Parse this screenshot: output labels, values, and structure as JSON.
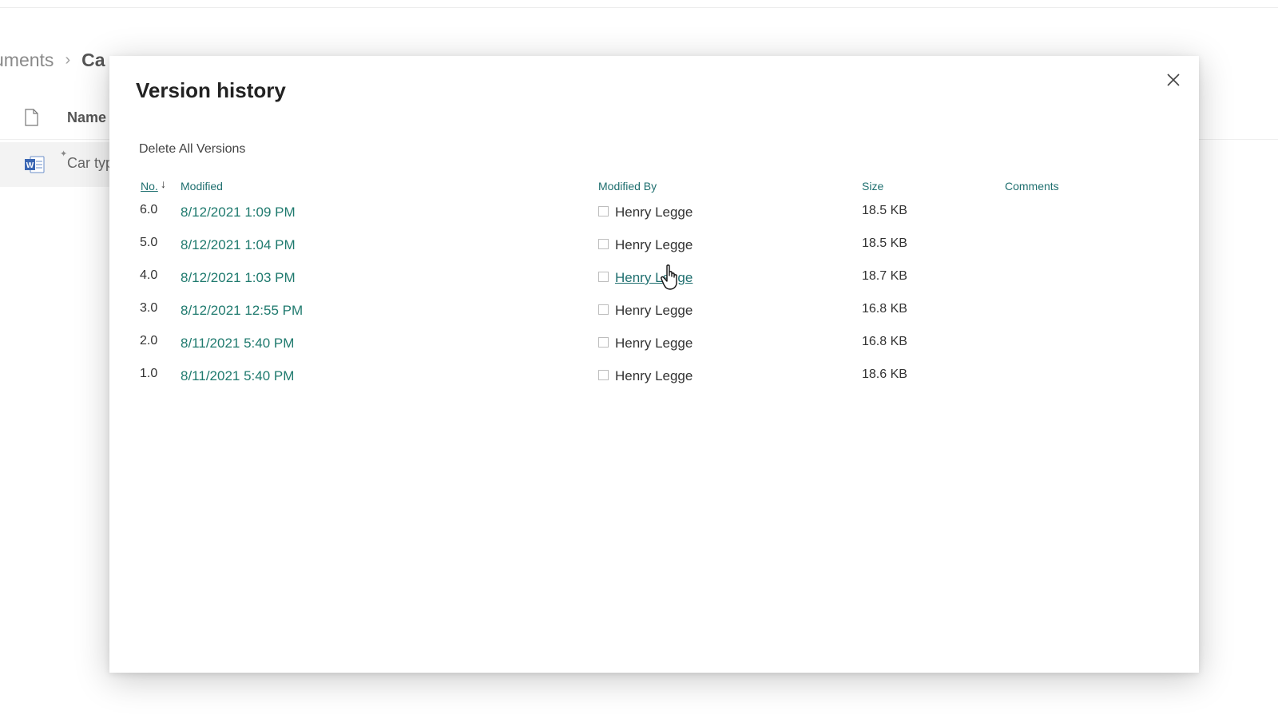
{
  "background": {
    "breadcrumb": {
      "parent": "uments",
      "current": "Ca"
    },
    "list_header": {
      "name_label": "Name",
      "file_icon": "document-icon"
    },
    "list_row": {
      "doc_name": "Car typ",
      "icon": "word-icon"
    }
  },
  "modal": {
    "title": "Version history",
    "close_icon": "close-icon",
    "delete_all_label": "Delete All Versions",
    "columns": {
      "no": "No.",
      "modified": "Modified",
      "modified_by": "Modified By",
      "size": "Size",
      "comments": "Comments"
    },
    "sort_icon": "arrow-down-icon",
    "versions": [
      {
        "no": "6.0",
        "modified": "8/12/2021 1:09 PM",
        "modified_by": "Henry Legge",
        "size": "18.5 KB"
      },
      {
        "no": "5.0",
        "modified": "8/12/2021 1:04 PM",
        "modified_by": "Henry Legge",
        "size": "18.5 KB"
      },
      {
        "no": "4.0",
        "modified": "8/12/2021 1:03 PM",
        "modified_by": "Henry Legge",
        "size": "18.7 KB"
      },
      {
        "no": "3.0",
        "modified": "8/12/2021 12:55 PM",
        "modified_by": "Henry Legge",
        "size": "16.8 KB"
      },
      {
        "no": "2.0",
        "modified": "8/11/2021 5:40 PM",
        "modified_by": "Henry Legge",
        "size": "16.8 KB"
      },
      {
        "no": "1.0",
        "modified": "8/11/2021 5:40 PM",
        "modified_by": "Henry Legge",
        "size": "18.6 KB"
      }
    ]
  },
  "colors": {
    "link_teal": "#1f7a6e",
    "header_teal": "#1f6f6f",
    "text_dark": "#333333"
  }
}
